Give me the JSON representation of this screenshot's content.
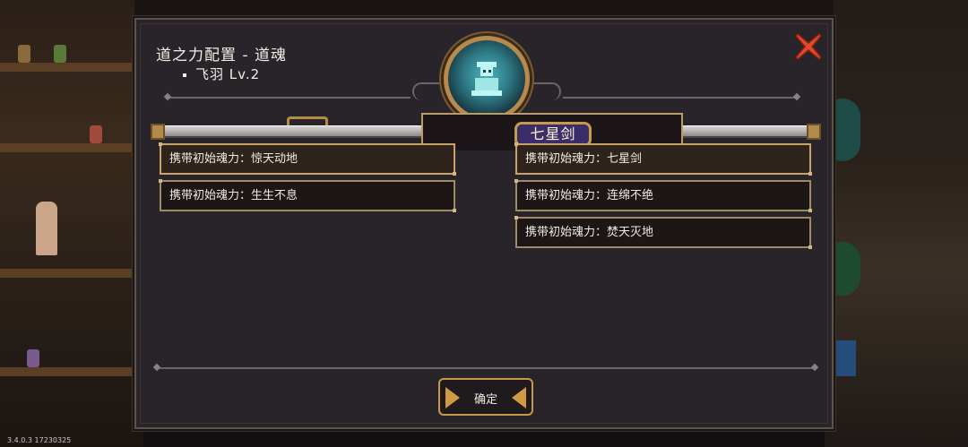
{
  "title": "道之力配置 - 道魂",
  "subtitle": "飞羽 Lv.2",
  "tab": {
    "label": "七星剑"
  },
  "left_list": [
    {
      "label": "携带初始魂力：惊天动地",
      "active": true
    },
    {
      "label": "携带初始魂力：生生不息",
      "active": false
    }
  ],
  "right_list": [
    {
      "label": "携带初始魂力：七星剑",
      "active": true
    },
    {
      "label": "携带初始魂力：连绵不绝",
      "active": false
    },
    {
      "label": "携带初始魂力：焚天灭地",
      "active": false
    }
  ],
  "confirm_label": "确定",
  "version": "3.4.0.3 17230325",
  "colors": {
    "accent": "#c59b4a",
    "close": "#e04a2e",
    "emblem": "#4fb3b8",
    "tab_bg": "#3a2d6a"
  }
}
